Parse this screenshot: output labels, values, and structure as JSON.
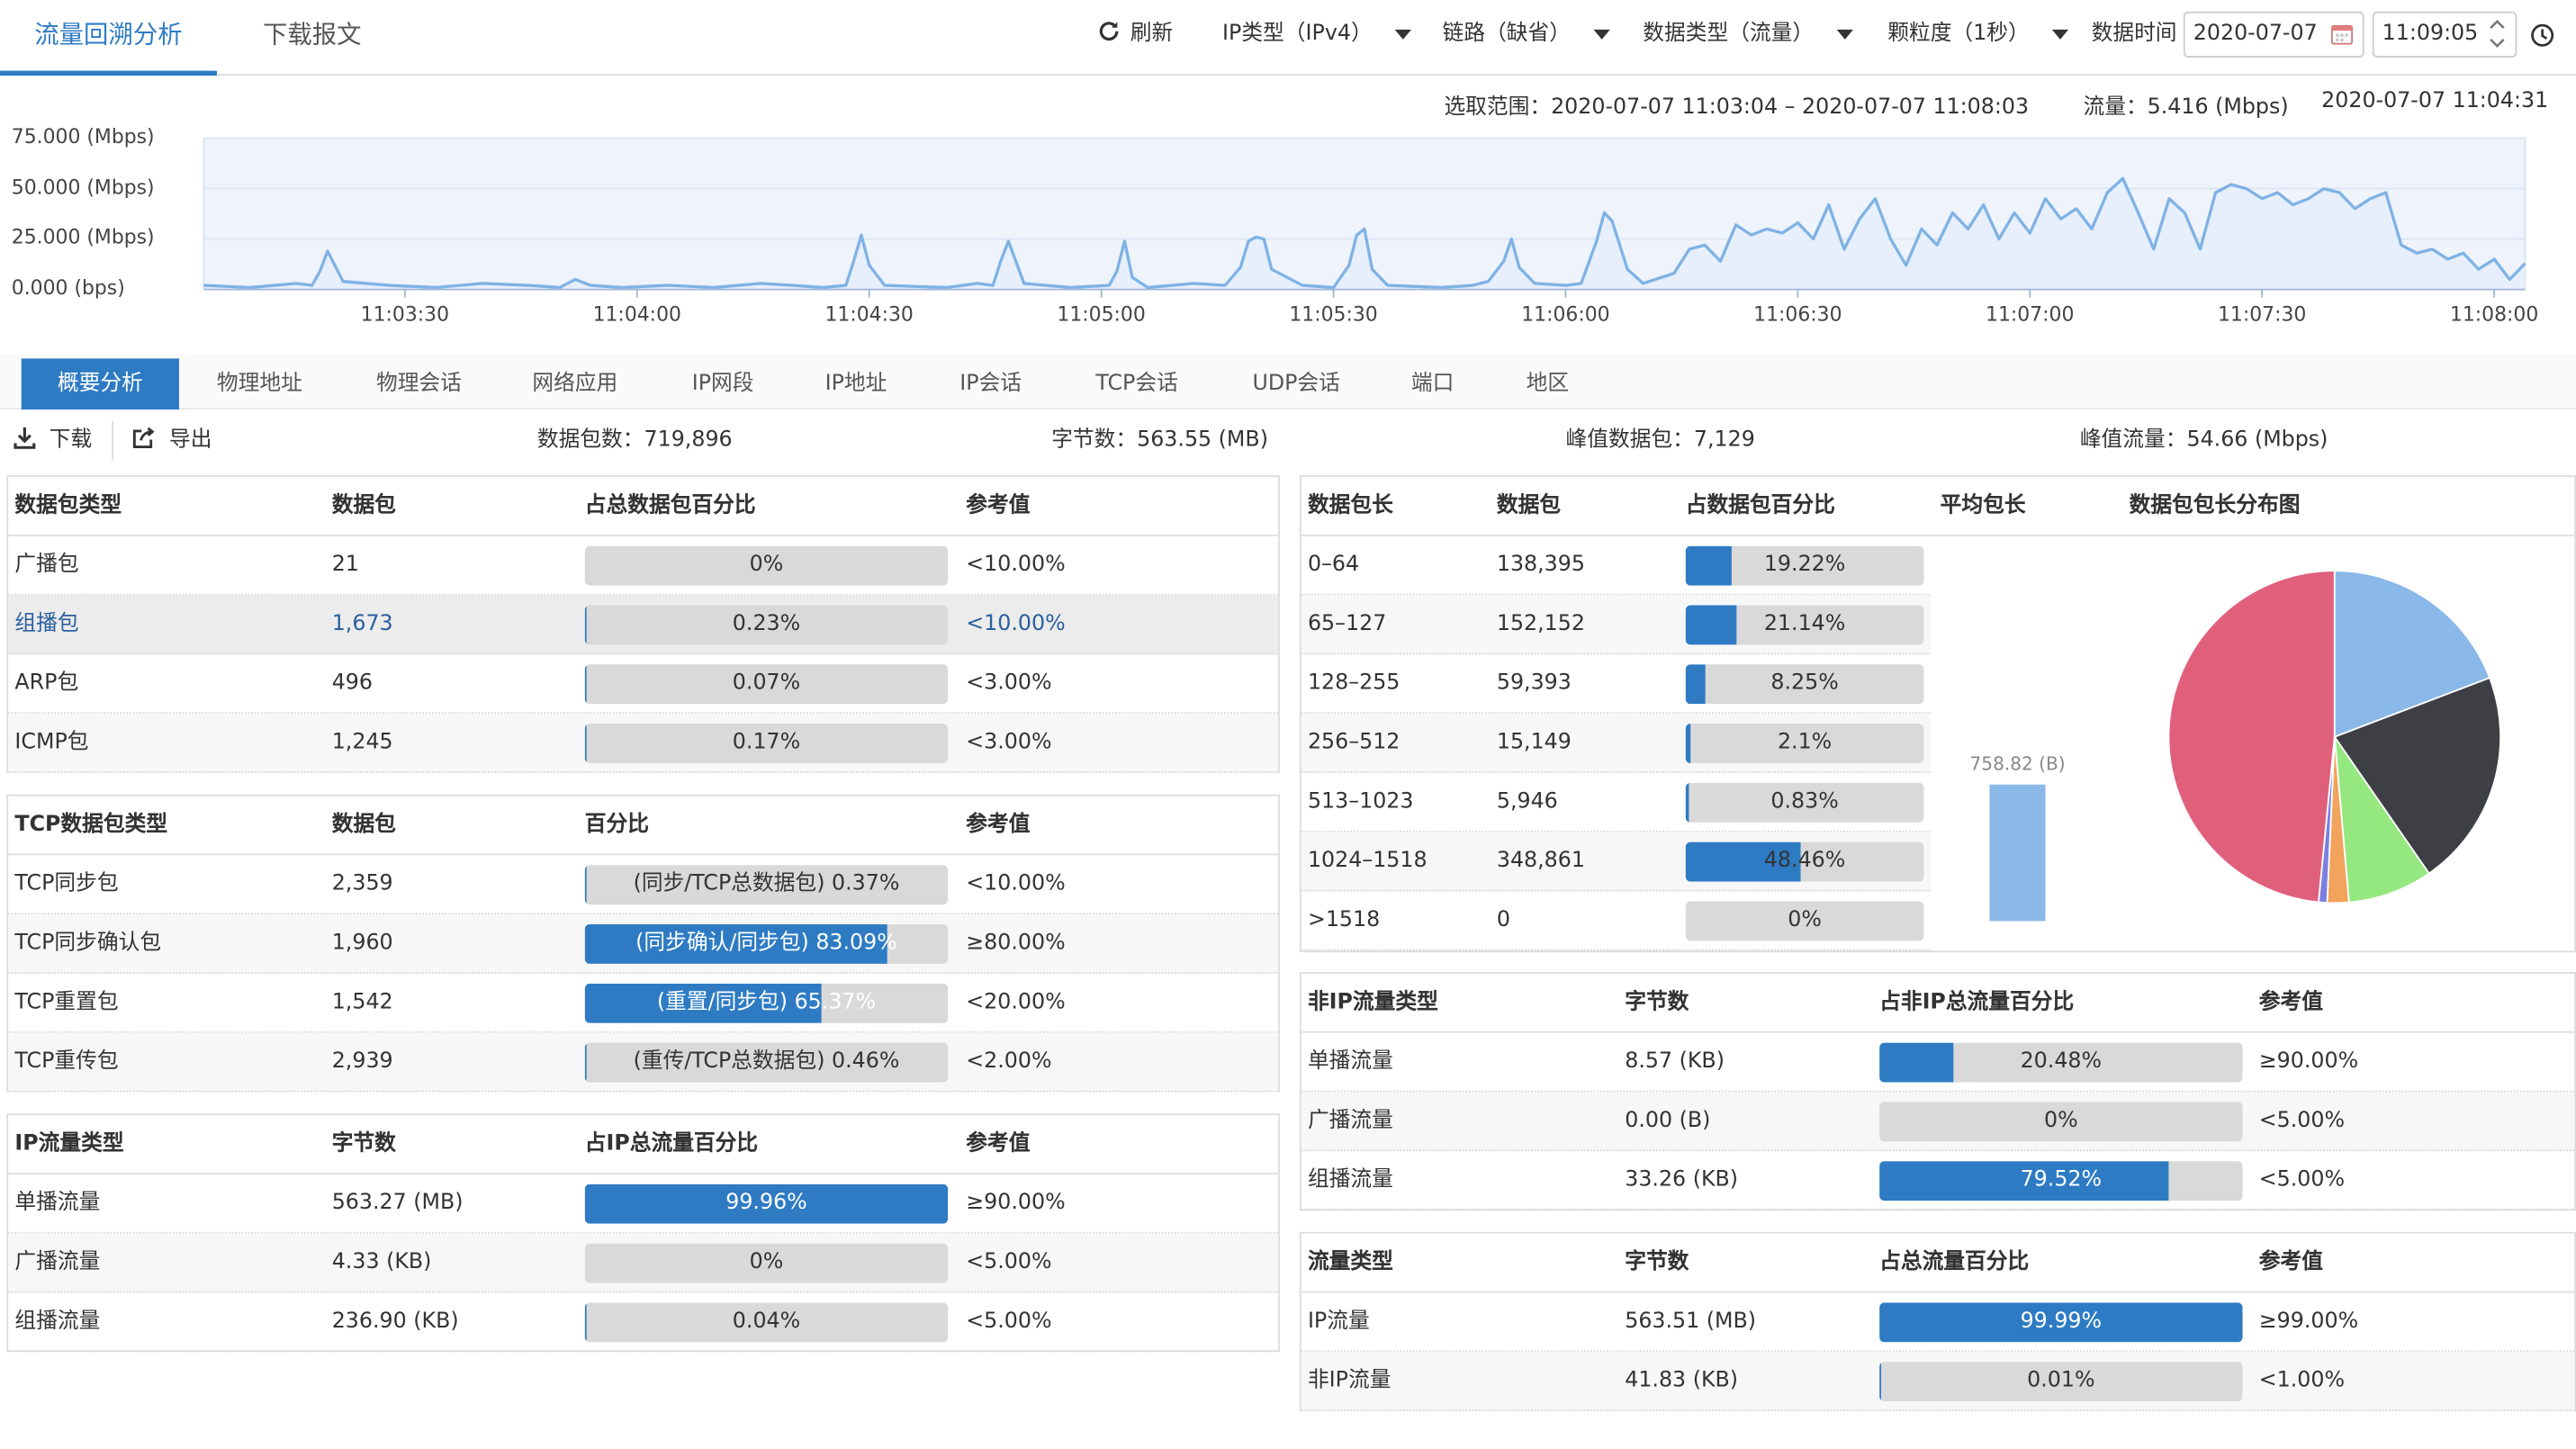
{
  "tabs": {
    "analysis": "流量回溯分析",
    "download": "下载报文"
  },
  "toolbar": {
    "refresh": "刷新",
    "ip_type": "IP类型（IPv4）",
    "link": "链路（缺省）",
    "data_type": "数据类型（流量）",
    "granularity": "颗粒度（1秒）",
    "time_label": "数据时间",
    "date_value": "2020-07-07",
    "time_value": "11:09:05"
  },
  "range_info": {
    "selection": "选取范围：2020-07-07 11:03:04 – 2020-07-07 11:08:03",
    "flow": "流量：5.416 (Mbps)",
    "timestamp": "2020-07-07 11:04:31"
  },
  "chart_data": {
    "type": "area",
    "y_tick_labels": [
      "75.000 (Mbps)",
      "50.000 (Mbps)",
      "25.000 (Mbps)",
      "0.000 (bps)"
    ],
    "y_ticks": [
      75,
      50,
      25,
      0
    ],
    "ylim": [
      0,
      75
    ],
    "x_tick_labels": [
      "11:03:30",
      "11:04:00",
      "11:04:30",
      "11:05:00",
      "11:05:30",
      "11:06:00",
      "11:06:30",
      "11:07:00",
      "11:07:30",
      "11:08:00"
    ],
    "x_ticks": [
      26,
      56,
      86,
      116,
      146,
      176,
      206,
      236,
      266,
      296
    ],
    "xlim": [
      0,
      300
    ],
    "x": [
      0,
      6,
      12,
      14,
      15,
      16,
      18,
      24,
      30,
      36,
      42,
      46,
      48,
      50,
      54,
      60,
      66,
      72,
      76,
      80,
      83,
      84,
      85,
      86,
      88,
      96,
      100,
      102,
      103,
      104,
      106,
      112,
      117,
      118,
      119,
      120,
      122,
      128,
      132,
      134,
      135,
      136,
      137,
      138,
      142,
      146,
      148,
      149,
      150,
      151,
      153,
      160,
      164,
      166,
      168,
      169,
      170,
      172,
      176,
      178,
      180,
      181,
      182,
      184,
      186,
      190,
      192,
      194,
      196,
      198,
      200,
      202,
      204,
      206,
      208,
      210,
      212,
      214,
      216,
      218,
      220,
      222,
      224,
      226,
      228,
      230,
      232,
      234,
      236,
      238,
      240,
      242,
      244,
      246,
      248,
      250,
      252,
      254,
      256,
      258,
      260,
      262,
      264,
      266,
      268,
      270,
      272,
      274,
      276,
      278,
      280,
      282,
      284,
      286,
      288,
      290,
      292,
      294,
      296,
      298,
      300
    ],
    "values": [
      2,
      1,
      3,
      2,
      9,
      19,
      4,
      2,
      1,
      3,
      2,
      1,
      5,
      2,
      1,
      2,
      1,
      3,
      2,
      1,
      2,
      14,
      27,
      12,
      2,
      1,
      3,
      2,
      14,
      24,
      3,
      1,
      2,
      9,
      24,
      6,
      1,
      3,
      2,
      11,
      24,
      26,
      25,
      10,
      2,
      1,
      12,
      27,
      30,
      10,
      2,
      1,
      2,
      4,
      14,
      25,
      11,
      3,
      2,
      3,
      24,
      38,
      34,
      10,
      3,
      8,
      20,
      22,
      14,
      32,
      27,
      30,
      28,
      33,
      25,
      42,
      20,
      35,
      45,
      25,
      12,
      30,
      22,
      38,
      30,
      42,
      25,
      38,
      28,
      45,
      35,
      40,
      30,
      48,
      55,
      38,
      20,
      45,
      38,
      20,
      48,
      52,
      50,
      45,
      48,
      42,
      45,
      50,
      48,
      40,
      45,
      48,
      22,
      18,
      20,
      15,
      18,
      10,
      15,
      5,
      13
    ]
  },
  "subtabs": [
    "概要分析",
    "物理地址",
    "物理会话",
    "网络应用",
    "IP网段",
    "IP地址",
    "IP会话",
    "TCP会话",
    "UDP会话",
    "端口",
    "地区"
  ],
  "summary": {
    "download": "下载",
    "export": "导出",
    "packets": "数据包数：719,896",
    "bytes": "字节数：563.55 (MB)",
    "peak_packets": "峰值数据包：7,129",
    "peak_flow": "峰值流量：54.66 (Mbps)"
  },
  "t1": {
    "headers": [
      "数据包类型",
      "数据包",
      "占总数据包百分比",
      "参考值"
    ],
    "rows": [
      {
        "name": "广播包",
        "count": "21",
        "pct_label": "0%",
        "pct": 0,
        "ref": "<10.00%"
      },
      {
        "name": "组播包",
        "count": "1,673",
        "pct_label": "0.23%",
        "pct": 0.23,
        "ref": "<10.00%"
      },
      {
        "name": "ARP包",
        "count": "496",
        "pct_label": "0.07%",
        "pct": 0.07,
        "ref": "<3.00%"
      },
      {
        "name": "ICMP包",
        "count": "1,245",
        "pct_label": "0.17%",
        "pct": 0.17,
        "ref": "<3.00%"
      }
    ]
  },
  "t2": {
    "headers": [
      "TCP数据包类型",
      "数据包",
      "百分比",
      "参考值"
    ],
    "rows": [
      {
        "name": "TCP同步包",
        "count": "2,359",
        "pct_label": "(同步/TCP总数据包) 0.37%",
        "pct": 0.37,
        "ref": "<10.00%"
      },
      {
        "name": "TCP同步确认包",
        "count": "1,960",
        "pct_label": "(同步确认/同步包) 83.09%",
        "pct": 83.09,
        "ref": "≥80.00%"
      },
      {
        "name": "TCP重置包",
        "count": "1,542",
        "pct_label": "(重置/同步包) 65.37%",
        "pct": 65.37,
        "ref": "<20.00%"
      },
      {
        "name": "TCP重传包",
        "count": "2,939",
        "pct_label": "(重传/TCP总数据包) 0.46%",
        "pct": 0.46,
        "ref": "<2.00%"
      }
    ]
  },
  "t3": {
    "headers": [
      "IP流量类型",
      "字节数",
      "占IP总流量百分比",
      "参考值"
    ],
    "rows": [
      {
        "name": "单播流量",
        "count": "563.27 (MB)",
        "pct_label": "99.96%",
        "pct": 99.96,
        "ref": "≥90.00%"
      },
      {
        "name": "广播流量",
        "count": "4.33 (KB)",
        "pct_label": "0%",
        "pct": 0,
        "ref": "<5.00%"
      },
      {
        "name": "组播流量",
        "count": "236.90 (KB)",
        "pct_label": "0.04%",
        "pct": 0.04,
        "ref": "<5.00%"
      }
    ]
  },
  "t4": {
    "headers": [
      "数据包长",
      "数据包",
      "占数据包百分比",
      "平均包长",
      "数据包包长分布图"
    ],
    "rows": [
      {
        "name": "0–64",
        "count": "138,395",
        "pct_label": "19.22%",
        "pct": 19.22
      },
      {
        "name": "65–127",
        "count": "152,152",
        "pct_label": "21.14%",
        "pct": 21.14
      },
      {
        "name": "128–255",
        "count": "59,393",
        "pct_label": "8.25%",
        "pct": 8.25
      },
      {
        "name": "256–512",
        "count": "15,149",
        "pct_label": "2.1%",
        "pct": 2.1
      },
      {
        "name": "513–1023",
        "count": "5,946",
        "pct_label": "0.83%",
        "pct": 0.83
      },
      {
        "name": "1024–1518",
        "count": "348,861",
        "pct_label": "48.46%",
        "pct": 48.46
      },
      {
        "name": ">1518",
        "count": "0",
        "pct_label": "0%",
        "pct": 0
      }
    ],
    "avg_label": "758.82 (B)",
    "avg_value": 758.82,
    "avg_max": 1000
  },
  "pie": {
    "slices": [
      {
        "value": 19.22,
        "color": "#8ab8e8"
      },
      {
        "value": 21.14,
        "color": "#3d3f45"
      },
      {
        "value": 8.25,
        "color": "#95e87f"
      },
      {
        "value": 2.1,
        "color": "#f2a35c"
      },
      {
        "value": 0.83,
        "color": "#7b7fe0"
      },
      {
        "value": 48.46,
        "color": "#e0607c"
      }
    ]
  },
  "t5": {
    "headers": [
      "非IP流量类型",
      "字节数",
      "占非IP总流量百分比",
      "参考值"
    ],
    "rows": [
      {
        "name": "单播流量",
        "count": "8.57 (KB)",
        "pct_label": "20.48%",
        "pct": 20.48,
        "ref": "≥90.00%"
      },
      {
        "name": "广播流量",
        "count": "0.00 (B)",
        "pct_label": "0%",
        "pct": 0,
        "ref": "<5.00%"
      },
      {
        "name": "组播流量",
        "count": "33.26 (KB)",
        "pct_label": "79.52%",
        "pct": 79.52,
        "ref": "<5.00%"
      }
    ]
  },
  "t6": {
    "headers": [
      "流量类型",
      "字节数",
      "占总流量百分比",
      "参考值"
    ],
    "rows": [
      {
        "name": "IP流量",
        "count": "563.51 (MB)",
        "pct_label": "99.99%",
        "pct": 99.99,
        "ref": "≥99.00%"
      },
      {
        "name": "非IP流量",
        "count": "41.83 (KB)",
        "pct_label": "0.01%",
        "pct": 0.01,
        "ref": "<1.00%"
      }
    ]
  },
  "colors": {
    "accent": "#2e7bc4",
    "bar_bg": "#d9d9d9",
    "chart_line": "#7fb2e5",
    "chart_fill": "#eef3fc"
  },
  "icons": [
    "refresh-icon",
    "calendar-icon",
    "clock-icon",
    "download-icon",
    "export-icon",
    "chevron-up-icon",
    "chevron-down-icon"
  ]
}
